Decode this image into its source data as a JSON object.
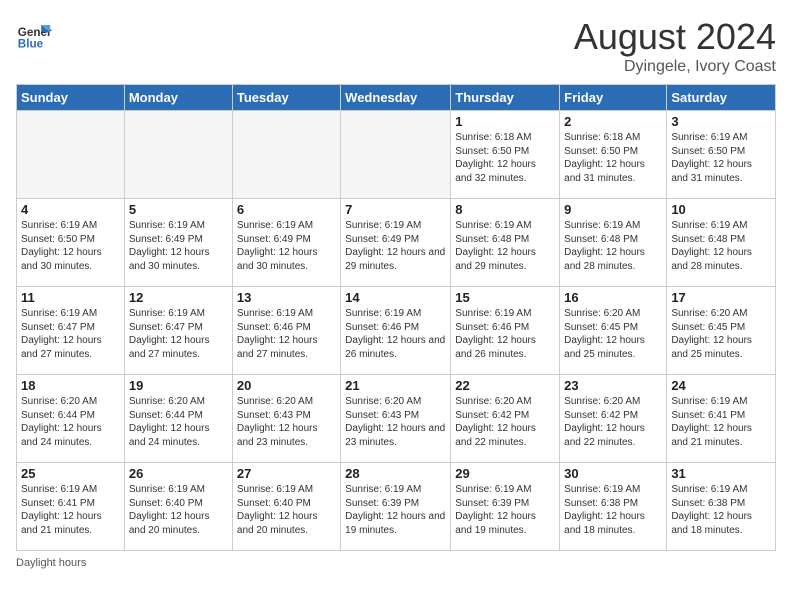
{
  "header": {
    "logo_line1": "General",
    "logo_line2": "Blue",
    "month_year": "August 2024",
    "location": "Dyingele, Ivory Coast"
  },
  "days_of_week": [
    "Sunday",
    "Monday",
    "Tuesday",
    "Wednesday",
    "Thursday",
    "Friday",
    "Saturday"
  ],
  "weeks": [
    [
      {
        "day": "",
        "empty": true
      },
      {
        "day": "",
        "empty": true
      },
      {
        "day": "",
        "empty": true
      },
      {
        "day": "",
        "empty": true
      },
      {
        "day": "1",
        "sunrise": "6:18 AM",
        "sunset": "6:50 PM",
        "daylight": "12 hours and 32 minutes."
      },
      {
        "day": "2",
        "sunrise": "6:18 AM",
        "sunset": "6:50 PM",
        "daylight": "12 hours and 31 minutes."
      },
      {
        "day": "3",
        "sunrise": "6:19 AM",
        "sunset": "6:50 PM",
        "daylight": "12 hours and 31 minutes."
      }
    ],
    [
      {
        "day": "4",
        "sunrise": "6:19 AM",
        "sunset": "6:50 PM",
        "daylight": "12 hours and 30 minutes."
      },
      {
        "day": "5",
        "sunrise": "6:19 AM",
        "sunset": "6:49 PM",
        "daylight": "12 hours and 30 minutes."
      },
      {
        "day": "6",
        "sunrise": "6:19 AM",
        "sunset": "6:49 PM",
        "daylight": "12 hours and 30 minutes."
      },
      {
        "day": "7",
        "sunrise": "6:19 AM",
        "sunset": "6:49 PM",
        "daylight": "12 hours and 29 minutes."
      },
      {
        "day": "8",
        "sunrise": "6:19 AM",
        "sunset": "6:48 PM",
        "daylight": "12 hours and 29 minutes."
      },
      {
        "day": "9",
        "sunrise": "6:19 AM",
        "sunset": "6:48 PM",
        "daylight": "12 hours and 28 minutes."
      },
      {
        "day": "10",
        "sunrise": "6:19 AM",
        "sunset": "6:48 PM",
        "daylight": "12 hours and 28 minutes."
      }
    ],
    [
      {
        "day": "11",
        "sunrise": "6:19 AM",
        "sunset": "6:47 PM",
        "daylight": "12 hours and 27 minutes."
      },
      {
        "day": "12",
        "sunrise": "6:19 AM",
        "sunset": "6:47 PM",
        "daylight": "12 hours and 27 minutes."
      },
      {
        "day": "13",
        "sunrise": "6:19 AM",
        "sunset": "6:46 PM",
        "daylight": "12 hours and 27 minutes."
      },
      {
        "day": "14",
        "sunrise": "6:19 AM",
        "sunset": "6:46 PM",
        "daylight": "12 hours and 26 minutes."
      },
      {
        "day": "15",
        "sunrise": "6:19 AM",
        "sunset": "6:46 PM",
        "daylight": "12 hours and 26 minutes."
      },
      {
        "day": "16",
        "sunrise": "6:20 AM",
        "sunset": "6:45 PM",
        "daylight": "12 hours and 25 minutes."
      },
      {
        "day": "17",
        "sunrise": "6:20 AM",
        "sunset": "6:45 PM",
        "daylight": "12 hours and 25 minutes."
      }
    ],
    [
      {
        "day": "18",
        "sunrise": "6:20 AM",
        "sunset": "6:44 PM",
        "daylight": "12 hours and 24 minutes."
      },
      {
        "day": "19",
        "sunrise": "6:20 AM",
        "sunset": "6:44 PM",
        "daylight": "12 hours and 24 minutes."
      },
      {
        "day": "20",
        "sunrise": "6:20 AM",
        "sunset": "6:43 PM",
        "daylight": "12 hours and 23 minutes."
      },
      {
        "day": "21",
        "sunrise": "6:20 AM",
        "sunset": "6:43 PM",
        "daylight": "12 hours and 23 minutes."
      },
      {
        "day": "22",
        "sunrise": "6:20 AM",
        "sunset": "6:42 PM",
        "daylight": "12 hours and 22 minutes."
      },
      {
        "day": "23",
        "sunrise": "6:20 AM",
        "sunset": "6:42 PM",
        "daylight": "12 hours and 22 minutes."
      },
      {
        "day": "24",
        "sunrise": "6:19 AM",
        "sunset": "6:41 PM",
        "daylight": "12 hours and 21 minutes."
      }
    ],
    [
      {
        "day": "25",
        "sunrise": "6:19 AM",
        "sunset": "6:41 PM",
        "daylight": "12 hours and 21 minutes."
      },
      {
        "day": "26",
        "sunrise": "6:19 AM",
        "sunset": "6:40 PM",
        "daylight": "12 hours and 20 minutes."
      },
      {
        "day": "27",
        "sunrise": "6:19 AM",
        "sunset": "6:40 PM",
        "daylight": "12 hours and 20 minutes."
      },
      {
        "day": "28",
        "sunrise": "6:19 AM",
        "sunset": "6:39 PM",
        "daylight": "12 hours and 19 minutes."
      },
      {
        "day": "29",
        "sunrise": "6:19 AM",
        "sunset": "6:39 PM",
        "daylight": "12 hours and 19 minutes."
      },
      {
        "day": "30",
        "sunrise": "6:19 AM",
        "sunset": "6:38 PM",
        "daylight": "12 hours and 18 minutes."
      },
      {
        "day": "31",
        "sunrise": "6:19 AM",
        "sunset": "6:38 PM",
        "daylight": "12 hours and 18 minutes."
      }
    ]
  ],
  "footer": "Daylight hours"
}
